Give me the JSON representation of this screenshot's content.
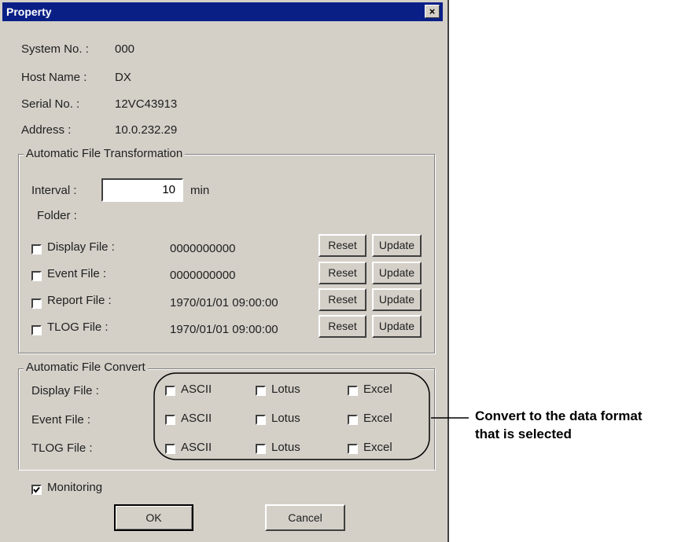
{
  "window": {
    "title": "Property",
    "close_glyph": "×"
  },
  "info": [
    {
      "label": "System No. :",
      "value": "000"
    },
    {
      "label": "Host Name :",
      "value": "DX"
    },
    {
      "label": "Serial No. :",
      "value": "12VC43913"
    },
    {
      "label": "Address :",
      "value": "10.0.232.29"
    }
  ],
  "auto_transform": {
    "title": "Automatic File Transformation",
    "interval_label": "Interval :",
    "interval_value": "10",
    "interval_unit": "min",
    "folder_label": "Folder :",
    "rows": [
      {
        "label": "Display File :",
        "value": "0000000000",
        "checked": false
      },
      {
        "label": "Event File :",
        "value": "0000000000",
        "checked": false
      },
      {
        "label": "Report File :",
        "value": "1970/01/01 09:00:00",
        "checked": false
      },
      {
        "label": "TLOG File :",
        "value": "1970/01/01 09:00:00",
        "checked": false
      }
    ],
    "reset_label": "Reset",
    "update_label": "Update"
  },
  "auto_convert": {
    "title": "Automatic File Convert",
    "rows": [
      {
        "label": "Display File :"
      },
      {
        "label": "Event File :"
      },
      {
        "label": "TLOG File :"
      }
    ],
    "formats": [
      "ASCII",
      "Lotus",
      "Excel"
    ]
  },
  "monitoring": {
    "label": "Monitoring",
    "checked": true
  },
  "buttons": {
    "ok": "OK",
    "cancel": "Cancel"
  },
  "callout": {
    "line1": "Convert to the data format",
    "line2": "that is selected"
  }
}
